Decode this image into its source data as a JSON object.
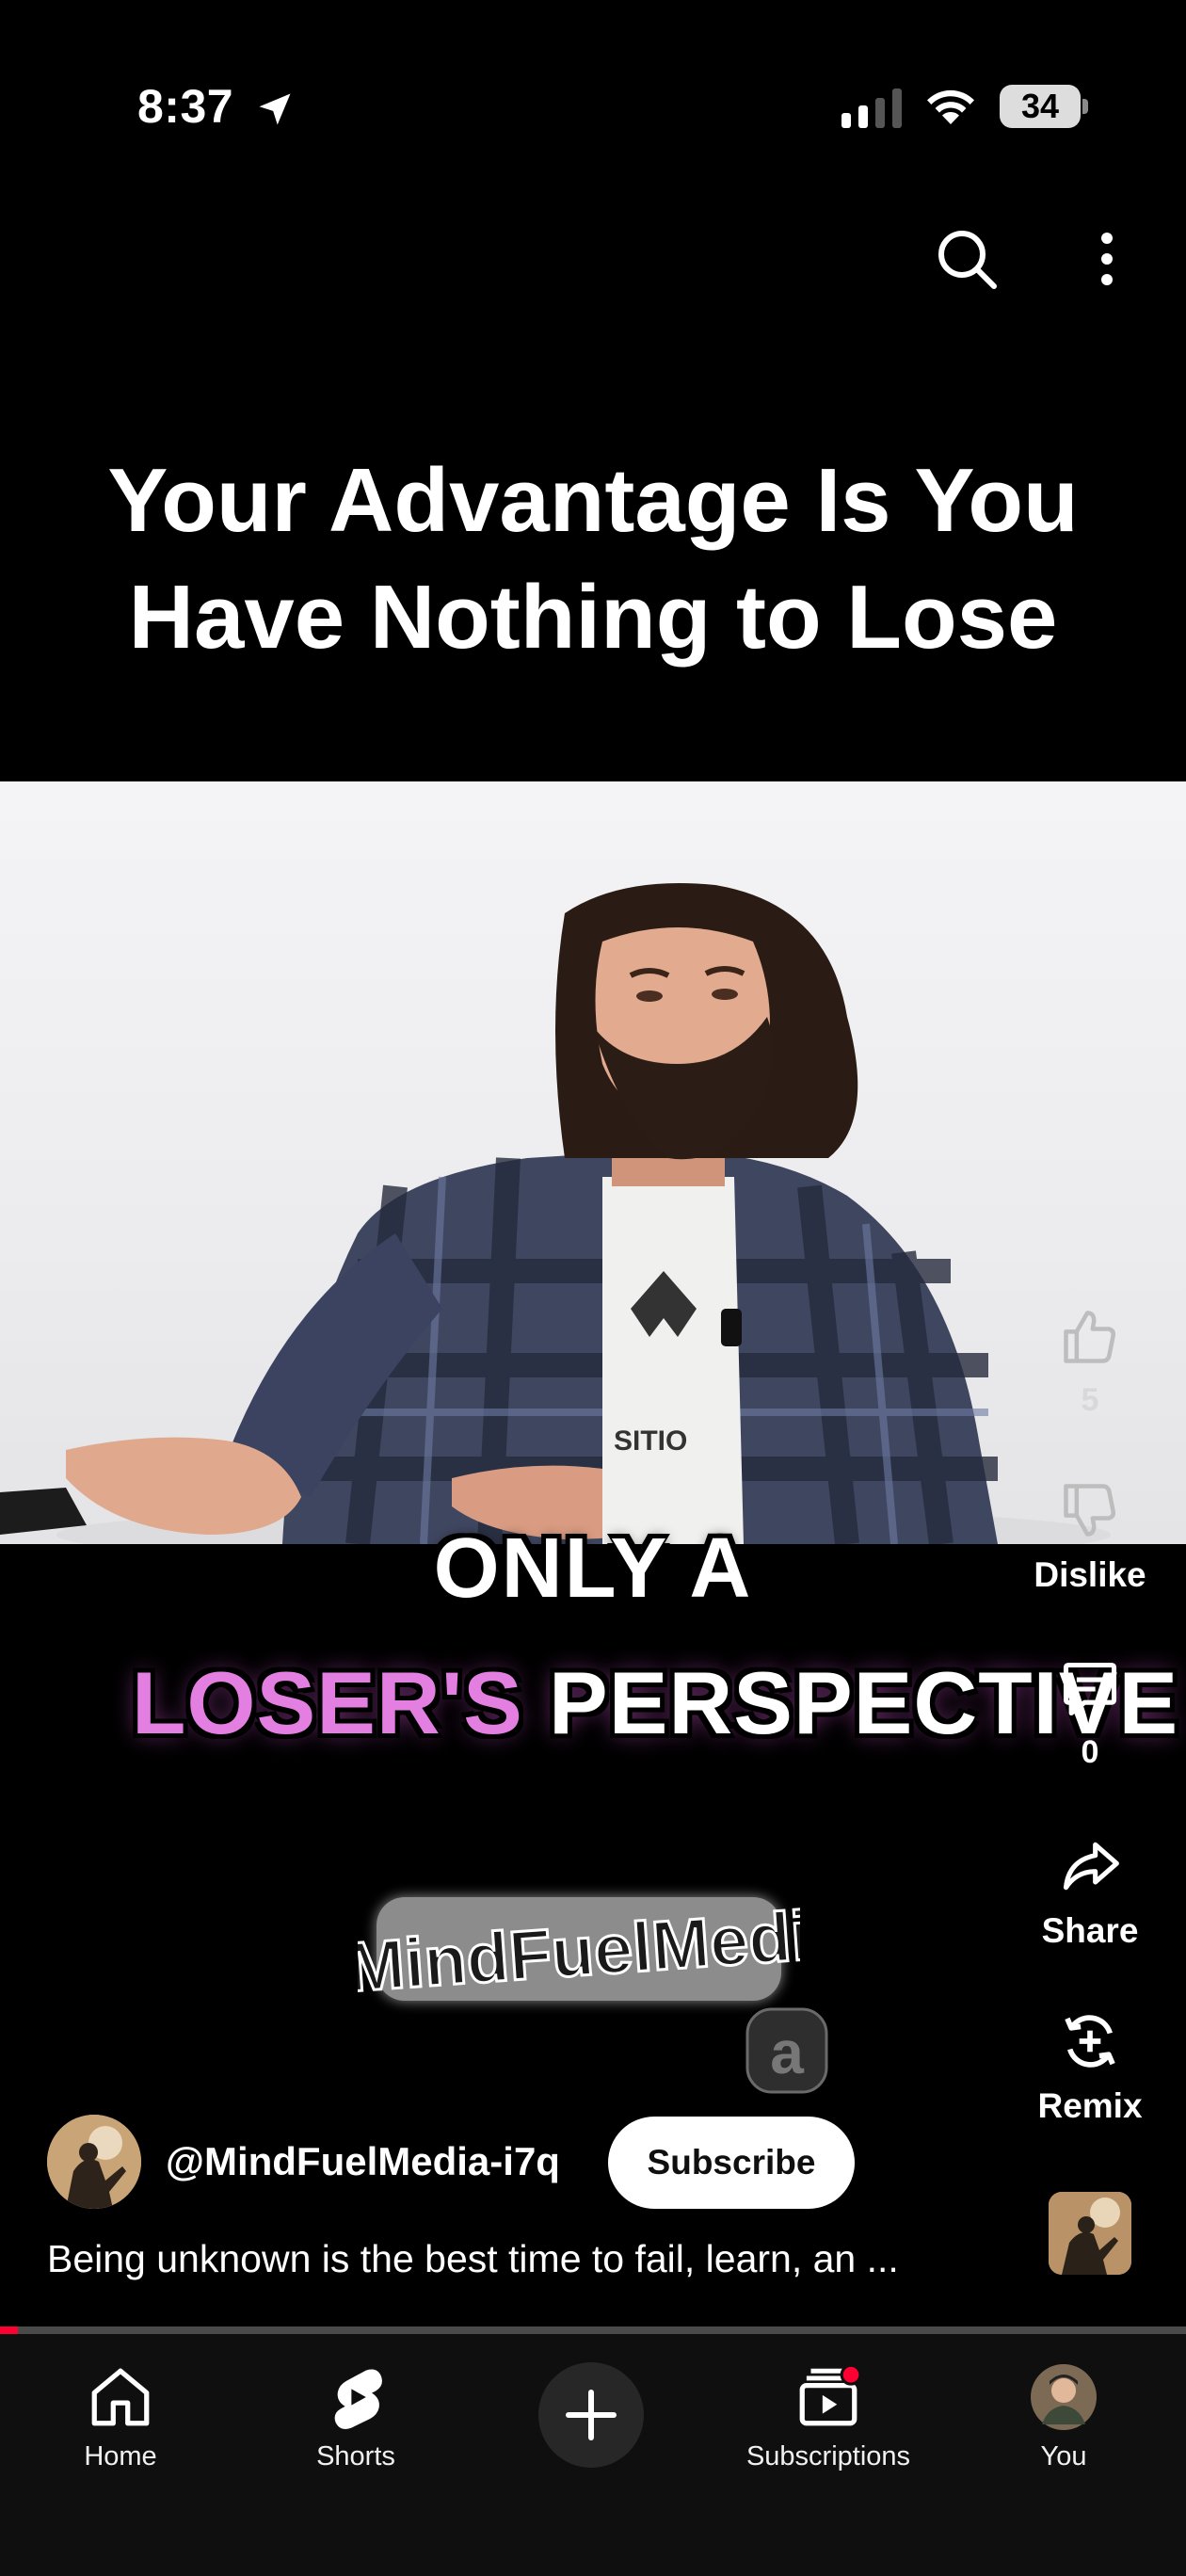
{
  "status_bar": {
    "time": "8:37",
    "battery": "34"
  },
  "video": {
    "title_line1": "Your Advantage Is You",
    "title_line2": "Have Nothing to Lose",
    "caption_line1": "ONLY A",
    "caption_line2_highlight": "LOSER'S",
    "caption_line2_rest": "PERSPECTIVE",
    "watermark": "MindFuelMedia"
  },
  "actions": {
    "like_count": "5",
    "dislike_label": "Dislike",
    "comment_count": "0",
    "share_label": "Share",
    "remix_label": "Remix"
  },
  "channel": {
    "handle": "@MindFuelMedia-i7q",
    "subscribe_label": "Subscribe",
    "description": "Being unknown is the best time to fail, learn, an ..."
  },
  "progress": {
    "fraction": 0.015
  },
  "bottom_nav": {
    "home": "Home",
    "shorts": "Shorts",
    "subscriptions": "Subscriptions",
    "you": "You"
  },
  "icons": {
    "location": "location-arrow-icon",
    "search": "search-icon",
    "more": "more-vertical-icon",
    "like": "thumbs-up-icon",
    "dislike": "thumbs-down-icon",
    "comment": "comment-icon",
    "share": "share-arrow-icon",
    "remix": "remix-icon"
  },
  "colors": {
    "accent_red": "#ff0033",
    "caption_pink": "#e27fe0"
  }
}
